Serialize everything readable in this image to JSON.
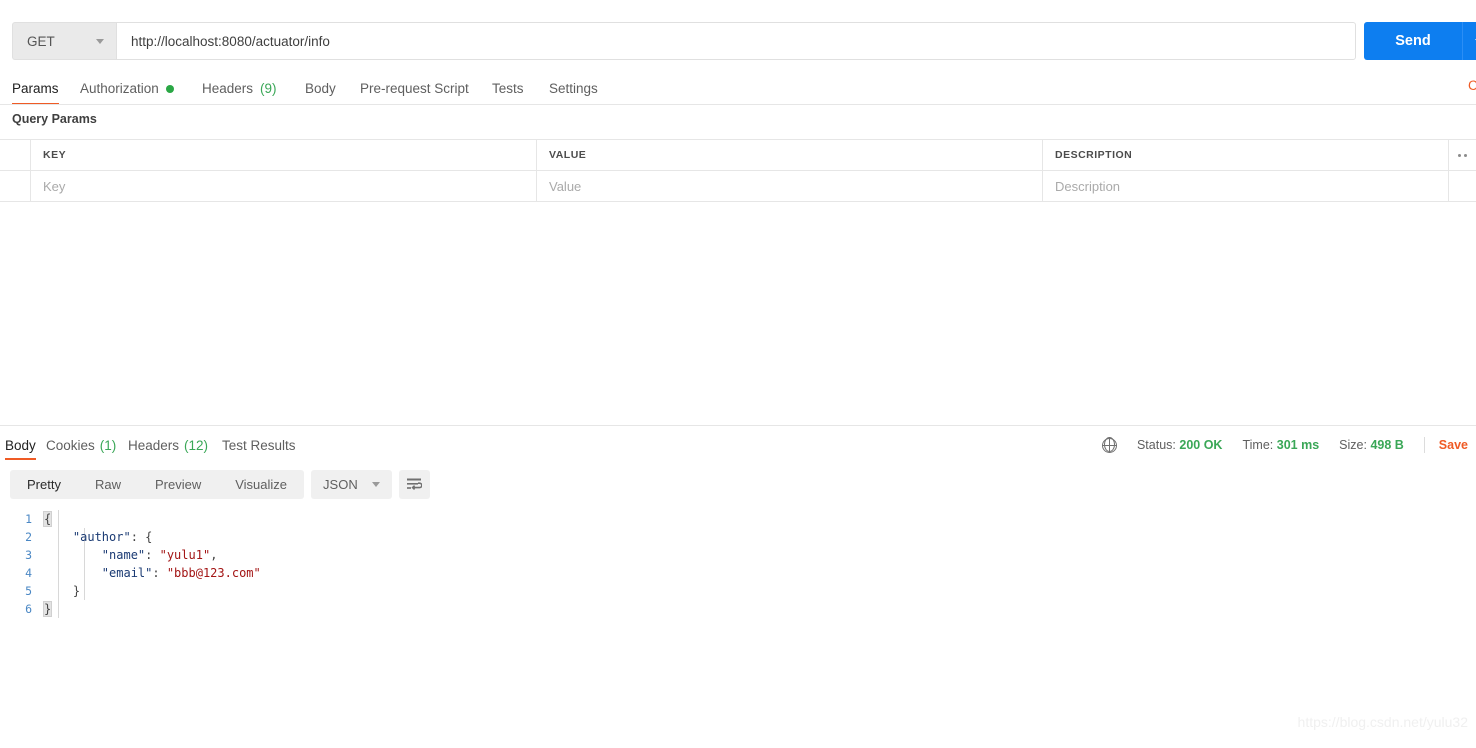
{
  "request": {
    "method": "GET",
    "url": "http://localhost:8080/actuator/info",
    "send_label": "Send",
    "tabs": [
      {
        "label": "Params",
        "count": "",
        "dot": false,
        "active": true
      },
      {
        "label": "Authorization",
        "count": "",
        "dot": true,
        "active": false
      },
      {
        "label": "Headers",
        "count": "(9)",
        "dot": false,
        "active": false
      },
      {
        "label": "Body",
        "count": "",
        "dot": false,
        "active": false
      },
      {
        "label": "Pre-request Script",
        "count": "",
        "dot": false,
        "active": false
      },
      {
        "label": "Tests",
        "count": "",
        "dot": false,
        "active": false
      },
      {
        "label": "Settings",
        "count": "",
        "dot": false,
        "active": false
      }
    ],
    "code_link": "C",
    "query_params_title": "Query Params",
    "table": {
      "headers": {
        "key": "KEY",
        "value": "VALUE",
        "description": "DESCRIPTION"
      },
      "rows": [
        {
          "key": "",
          "value": "",
          "description": ""
        }
      ],
      "placeholders": {
        "key": "Key",
        "value": "Value",
        "description": "Description"
      }
    }
  },
  "response": {
    "tabs": [
      {
        "label": "Body",
        "count": "",
        "active": true
      },
      {
        "label": "Cookies",
        "count": "(1)",
        "active": false
      },
      {
        "label": "Headers",
        "count": "(12)",
        "active": false
      },
      {
        "label": "Test Results",
        "count": "",
        "active": false
      }
    ],
    "meta": {
      "status_label": "Status:",
      "status_value": "200 OK",
      "time_label": "Time:",
      "time_value": "301 ms",
      "size_label": "Size:",
      "size_value": "498 B",
      "save_label": "Save"
    },
    "format_tabs": [
      {
        "label": "Pretty",
        "active": true
      },
      {
        "label": "Raw",
        "active": false
      },
      {
        "label": "Preview",
        "active": false
      },
      {
        "label": "Visualize",
        "active": false
      }
    ],
    "language": "JSON",
    "body_lines": [
      {
        "n": "1",
        "indent": 0,
        "parts": [
          {
            "t": "{",
            "c": "brace"
          }
        ]
      },
      {
        "n": "2",
        "indent": 4,
        "parts": [
          {
            "t": "\"author\"",
            "c": "key"
          },
          {
            "t": ": {",
            "c": "pun"
          }
        ]
      },
      {
        "n": "3",
        "indent": 8,
        "parts": [
          {
            "t": "\"name\"",
            "c": "key"
          },
          {
            "t": ": ",
            "c": "pun"
          },
          {
            "t": "\"yulu1\"",
            "c": "str"
          },
          {
            "t": ",",
            "c": "pun"
          }
        ]
      },
      {
        "n": "4",
        "indent": 8,
        "parts": [
          {
            "t": "\"email\"",
            "c": "key"
          },
          {
            "t": ": ",
            "c": "pun"
          },
          {
            "t": "\"bbb@123.com\"",
            "c": "str"
          }
        ]
      },
      {
        "n": "5",
        "indent": 4,
        "parts": [
          {
            "t": "}",
            "c": "pun"
          }
        ]
      },
      {
        "n": "6",
        "indent": 0,
        "parts": [
          {
            "t": "}",
            "c": "brace"
          }
        ]
      }
    ]
  },
  "watermark": "https://blog.csdn.net/yulu32",
  "colors": {
    "accent": "#ef5b25",
    "send_blue": "#0d7ef0",
    "status_green": "#3aa757",
    "json_key": "#1a3a73",
    "json_string": "#a31515",
    "lineno": "#4a87c4"
  }
}
